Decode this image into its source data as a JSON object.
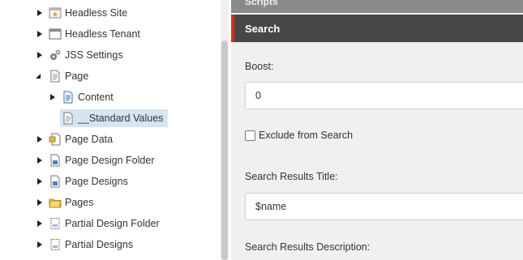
{
  "tree": {
    "items": [
      {
        "label": "Headless Site",
        "icon": "site-star-icon",
        "expander": "right",
        "indent": 0,
        "selected": false
      },
      {
        "label": "Headless Tenant",
        "icon": "window-icon",
        "expander": "right",
        "indent": 0,
        "selected": false
      },
      {
        "label": "JSS Settings",
        "icon": "gears-icon",
        "expander": "right",
        "indent": 0,
        "selected": false
      },
      {
        "label": "Page",
        "icon": "document-icon",
        "expander": "down",
        "indent": 0,
        "selected": false
      },
      {
        "label": "Content",
        "icon": "document-blue-icon",
        "expander": "right",
        "indent": 1,
        "selected": false
      },
      {
        "label": "__Standard Values",
        "icon": "document-icon",
        "expander": "none",
        "indent": 1,
        "selected": true
      },
      {
        "label": "Page Data",
        "icon": "page-data-icon",
        "expander": "right",
        "indent": 0,
        "selected": false
      },
      {
        "label": "Page Design Folder",
        "icon": "design-folder-icon",
        "expander": "right",
        "indent": 0,
        "selected": false
      },
      {
        "label": "Page Designs",
        "icon": "design-folder-icon",
        "expander": "right",
        "indent": 0,
        "selected": false
      },
      {
        "label": "Pages",
        "icon": "folder-icon",
        "expander": "right",
        "indent": 0,
        "selected": false
      },
      {
        "label": "Partial Design Folder",
        "icon": "partial-design-icon",
        "expander": "right",
        "indent": 0,
        "selected": false
      },
      {
        "label": "Partial Designs",
        "icon": "partial-design-icon",
        "expander": "right",
        "indent": 0,
        "selected": false
      }
    ]
  },
  "editor": {
    "previous_section": "Scripts",
    "section_title": "Search",
    "boost_label": "Boost:",
    "boost_value": "0",
    "exclude_label": "Exclude from Search",
    "results_title_label": "Search Results Title:",
    "results_title_value": "$name",
    "results_description_label": "Search Results Description:"
  },
  "colors": {
    "accent": "#dc291e",
    "section_header_bg": "#474747",
    "selected_bg": "#d4e6f3"
  }
}
